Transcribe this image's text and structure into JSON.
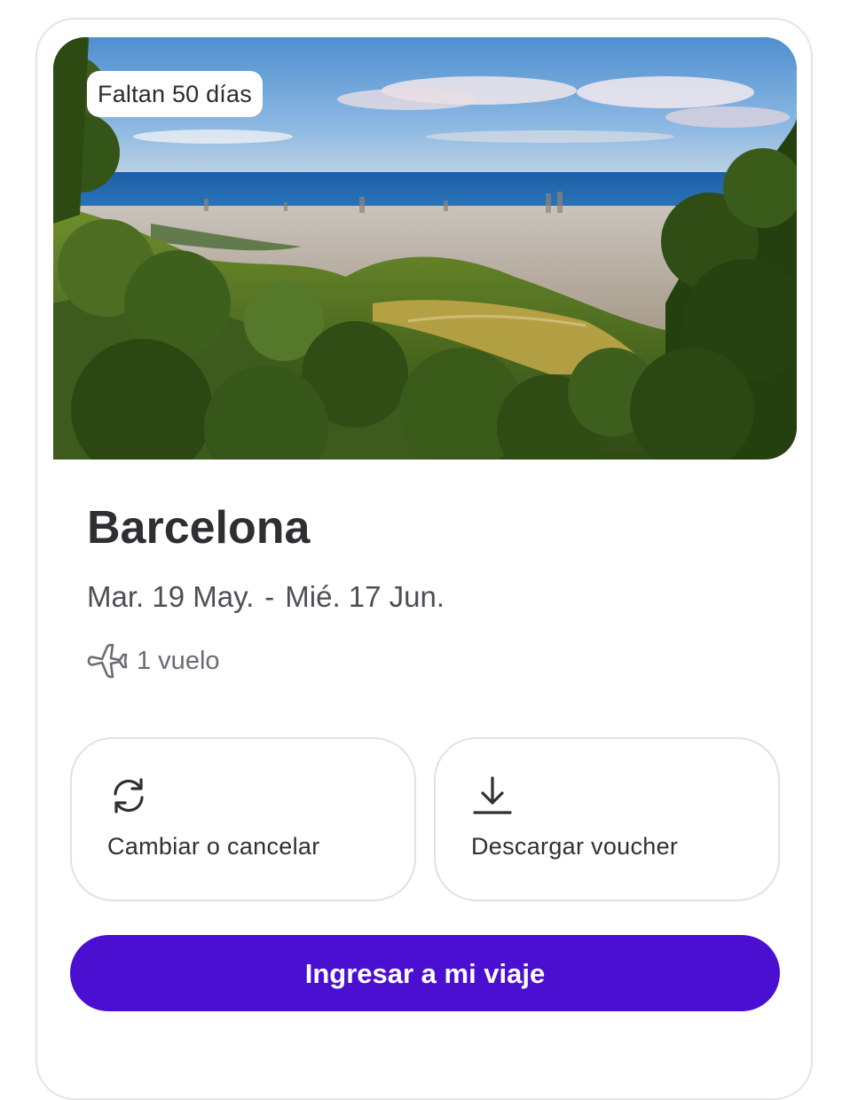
{
  "trip_card": {
    "countdown": "Faltan 50 días",
    "title": "Barcelona",
    "start_date": "Mar. 19 May.",
    "date_separator": "-",
    "end_date": "Mié. 17 Jun.",
    "flights": "1 vuelo",
    "icons": {
      "flight": "plane-icon",
      "change": "refresh-icon",
      "download": "download-icon"
    }
  },
  "actions": {
    "change_label": "Cambiar o cancelar",
    "voucher_label": "Descargar voucher",
    "primary_label": "Ingresar a mi viaje"
  },
  "colors": {
    "primary": "#4a0fd0",
    "card_border": "#e4e4ea",
    "text": "#2f3033"
  }
}
